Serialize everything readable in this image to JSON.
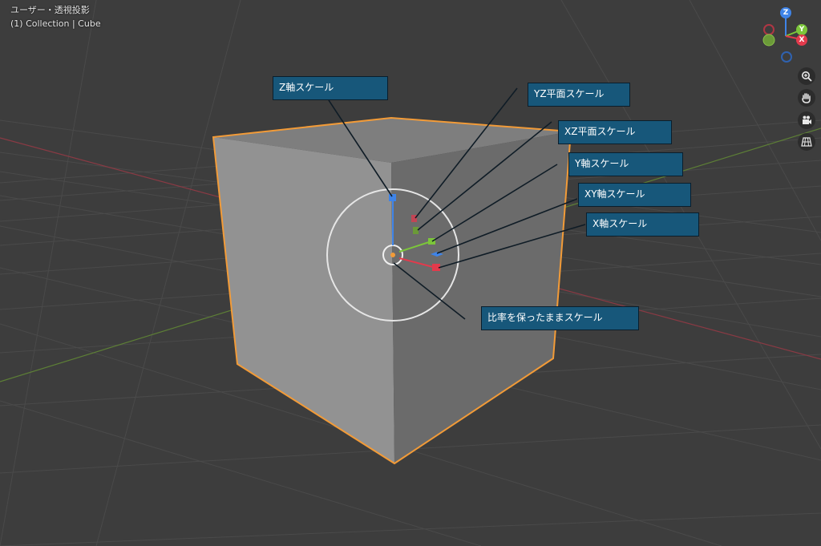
{
  "viewport": {
    "view_title": "ユーザー・透視投影",
    "collection_info": "(1) Collection | Cube",
    "colors": {
      "background": "#3d3d3d",
      "x_axis": "#e33a4c",
      "y_axis": "#7cc63a",
      "z_axis": "#3f84e8",
      "selection_outline": "#f29b38",
      "callout_fill": "#17577a"
    }
  },
  "gizmo": {
    "z_label": "Z",
    "y_label": "Y",
    "x_label": "X"
  },
  "nav_icons": [
    "zoom-icon",
    "pan-hand-icon",
    "camera-icon",
    "grid-icon"
  ],
  "callouts": {
    "z_axis": "Z軸スケール",
    "yz_plane": "YZ平面スケール",
    "xz_plane": "XZ平面スケール",
    "y_axis": "Y軸スケール",
    "xy_plane": "XY軸スケール",
    "x_axis": "X軸スケール",
    "uniform": "比率を保ったままスケール"
  }
}
